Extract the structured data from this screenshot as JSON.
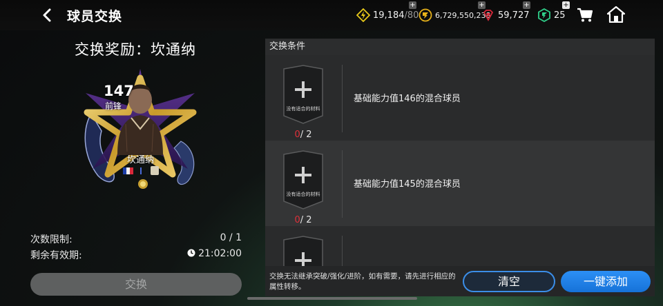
{
  "header": {
    "title": "球员交换"
  },
  "currencies": [
    {
      "name": "energy",
      "icon": "lightning-icon",
      "color": "#e8c91a",
      "value": "19,184",
      "max": "/80"
    },
    {
      "name": "coins",
      "icon": "coin-icon",
      "color": "#e8b21a",
      "value": "6,729,550,238",
      "max": ""
    },
    {
      "name": "gems",
      "icon": "gem-icon",
      "color": "#d8283a",
      "value": "59,727",
      "max": ""
    },
    {
      "name": "tokens",
      "icon": "token-icon",
      "color": "#2fd08a",
      "value": "25",
      "max": ""
    }
  ],
  "reward": {
    "title": "交换奖励：坎通纳",
    "card": {
      "rating": "147",
      "position": "前锋",
      "name": "坎通纳"
    }
  },
  "limits": {
    "count_label": "次数限制:",
    "count_value": "0 / 1",
    "validity_label": "剩余有效期:",
    "validity_value": "21:02:00"
  },
  "exchange_label": "交换",
  "conditions": {
    "header": "交换条件",
    "items": [
      {
        "slot_text": "没有适合的材料",
        "have": "0",
        "need": "/ 2",
        "desc": "基础能力值146的混合球员"
      },
      {
        "slot_text": "没有适合的材料",
        "have": "0",
        "need": "/ 2",
        "desc": "基础能力值145的混合球员"
      },
      {
        "slot_text": "",
        "have": "",
        "need": "",
        "desc": ""
      }
    ]
  },
  "bottom": {
    "notice": "交换无法继承突破/强化/进阶，如有需要，请先进行相应的属性转移。",
    "clear_label": "清空",
    "add_all_label": "一键添加"
  },
  "colors": {
    "accent": "#2c8ff5",
    "warning": "#e0303a"
  }
}
